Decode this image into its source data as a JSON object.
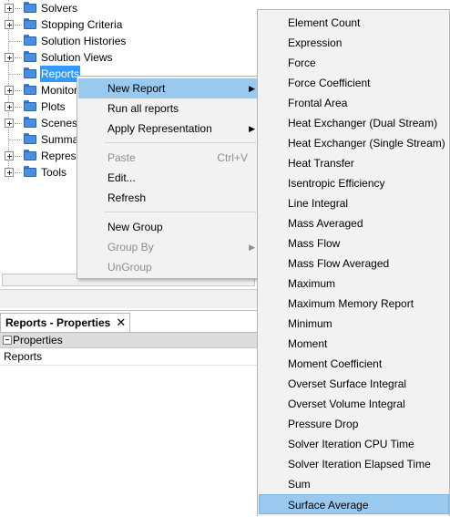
{
  "tree": {
    "items": [
      {
        "label": "Solvers",
        "expandable": true
      },
      {
        "label": "Stopping Criteria",
        "expandable": true
      },
      {
        "label": "Solution Histories",
        "expandable": false
      },
      {
        "label": "Solution Views",
        "expandable": true
      },
      {
        "label": "Reports",
        "expandable": false,
        "selected": true
      },
      {
        "label": "Monitors",
        "expandable": true
      },
      {
        "label": "Plots",
        "expandable": true
      },
      {
        "label": "Scenes",
        "expandable": true
      },
      {
        "label": "Summar",
        "expandable": false
      },
      {
        "label": "Represe",
        "expandable": true
      },
      {
        "label": "Tools",
        "expandable": true
      }
    ]
  },
  "context_menu": {
    "items": [
      {
        "label": "New Report",
        "has_submenu": true,
        "highlighted": true
      },
      {
        "label": "Run all reports"
      },
      {
        "label": "Apply Representation",
        "has_submenu": true
      },
      {
        "separator": true
      },
      {
        "label": "Paste",
        "shortcut": "Ctrl+V",
        "disabled": true
      },
      {
        "label": "Edit..."
      },
      {
        "label": "Refresh"
      },
      {
        "separator": true
      },
      {
        "label": "New Group"
      },
      {
        "label": "Group By",
        "has_submenu": true,
        "disabled": true
      },
      {
        "label": "UnGroup",
        "disabled": true
      }
    ]
  },
  "submenu": {
    "items": [
      "Element Count",
      "Expression",
      "Force",
      "Force Coefficient",
      "Frontal Area",
      "Heat Exchanger (Dual Stream)",
      "Heat Exchanger (Single Stream)",
      "Heat Transfer",
      "Isentropic Efficiency",
      "Line Integral",
      "Mass Averaged",
      "Mass Flow",
      "Mass Flow Averaged",
      "Maximum",
      "Maximum Memory Report",
      "Minimum",
      "Moment",
      "Moment Coefficient",
      "Overset Surface Integral",
      "Overset Volume Integral",
      "Pressure Drop",
      "Solver Iteration CPU Time",
      "Solver Iteration Elapsed Time",
      "Sum",
      "Surface Average"
    ],
    "highlighted": "Surface Average"
  },
  "properties": {
    "tab_label": "Reports - Properties",
    "close_glyph": "✕",
    "section_label": "Properties",
    "row_value": "Reports"
  },
  "colors": {
    "selection": "#3399ff",
    "menu_highlight": "#99c9ef",
    "folder": "#4a8ee0"
  }
}
